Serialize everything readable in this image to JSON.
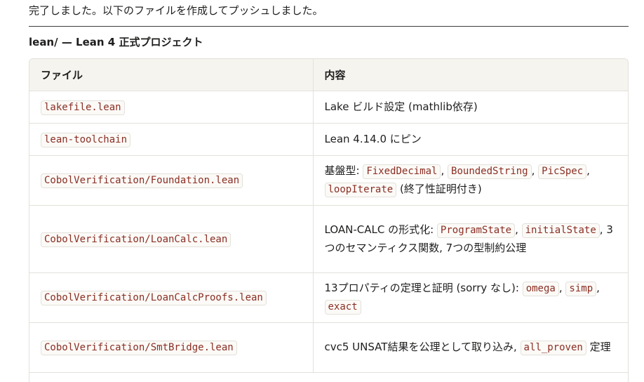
{
  "intro": "完了しました。以下のファイルを作成してプッシュしました。",
  "section_title": "lean/ — Lean 4 正式プロジェクト",
  "table": {
    "headers": [
      "ファイル",
      "内容"
    ],
    "rows": [
      {
        "file": "lakefile.lean",
        "content": [
          {
            "t": "text",
            "v": "Lake ビルド設定 (mathlib依存)"
          }
        ]
      },
      {
        "file": "lean-toolchain",
        "content": [
          {
            "t": "text",
            "v": "Lean 4.14.0 にピン"
          }
        ]
      },
      {
        "file": "CobolVerification/Foundation.lean",
        "content": [
          {
            "t": "text",
            "v": "基盤型: "
          },
          {
            "t": "code",
            "v": "FixedDecimal"
          },
          {
            "t": "text",
            "v": ", "
          },
          {
            "t": "code",
            "v": "BoundedString"
          },
          {
            "t": "text",
            "v": ", "
          },
          {
            "t": "code",
            "v": "PicSpec"
          },
          {
            "t": "text",
            "v": ", "
          },
          {
            "t": "code",
            "v": "loopIterate"
          },
          {
            "t": "text",
            "v": " (終了性証明付き)"
          }
        ]
      },
      {
        "file": "CobolVerification/LoanCalc.lean",
        "content": [
          {
            "t": "text",
            "v": "LOAN-CALC の形式化: "
          },
          {
            "t": "code",
            "v": "ProgramState"
          },
          {
            "t": "text",
            "v": ", "
          },
          {
            "t": "code",
            "v": "initialState"
          },
          {
            "t": "text",
            "v": ", 3つのセマンティクス関数, 7つの型制約公理"
          }
        ]
      },
      {
        "file": "CobolVerification/LoanCalcProofs.lean",
        "content": [
          {
            "t": "text",
            "v": "13プロパティの定理と証明 (sorry なし): "
          },
          {
            "t": "code",
            "v": "omega"
          },
          {
            "t": "text",
            "v": ", "
          },
          {
            "t": "code",
            "v": "simp"
          },
          {
            "t": "text",
            "v": ", "
          },
          {
            "t": "code",
            "v": "exact"
          }
        ]
      },
      {
        "file": "CobolVerification/SmtBridge.lean",
        "content": [
          {
            "t": "text",
            "v": "cvc5 UNSAT結果を公理として取り込み, "
          },
          {
            "t": "code",
            "v": "all_proven"
          },
          {
            "t": "text",
            "v": " 定理"
          }
        ]
      }
    ]
  }
}
